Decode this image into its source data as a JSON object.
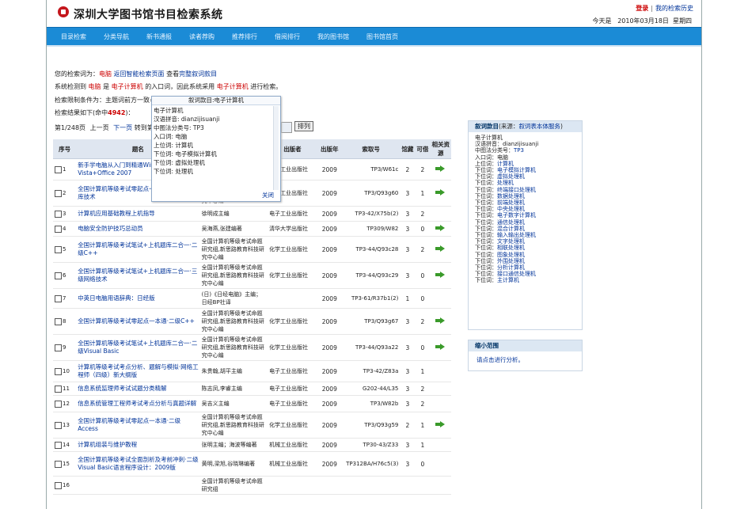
{
  "header": {
    "title": "深圳大学图书馆书目检索系统",
    "login": "登录",
    "separator": "|",
    "history": "我的检索历史",
    "date_label": "今天是",
    "date": "2010年03月18日",
    "weekday": "星期四"
  },
  "nav": [
    "目录检索",
    "分类导航",
    "新书通报",
    "读者荐购",
    "推荐排行",
    "借阅排行",
    "我的图书馆",
    "图书馆首页"
  ],
  "search_info": {
    "query_label": "您的检索词为：",
    "query": "电脑",
    "back_link": "返回智能检索页面",
    "view_label": "查看",
    "full_link": "完整叙词款目",
    "detect_pre": "系统检测到",
    "detect_term": "电脑",
    "detect_is": "是",
    "detect_target": "电子计算机",
    "detect_mid": "的入口词，因此系统采用",
    "detect_target2": "电子计算机",
    "detect_post": "进行检索。",
    "limit_label": "检索限制条件为：主题词前方一致=",
    "result_label": "检索结果如下(命中",
    "hits": "4942",
    "result_end": ")："
  },
  "pager": {
    "page_info": "第1/248页",
    "prev": "上一页",
    "next": "下一页",
    "jump_label": "转到第",
    "page_value": "1",
    "sort_button": "排列"
  },
  "table": {
    "headers": [
      "序号",
      "题名",
      "著者",
      "出版者",
      "出版年",
      "索取号",
      "馆藏",
      "可借",
      "相关资源"
    ],
    "rows": [
      {
        "n": "1",
        "title": "新手学电脑从入门到精通Windows Vista+Office 2007",
        "author": "",
        "publisher": "机械工业出版社",
        "year": "2009",
        "call": "TP3/W61c",
        "holdings": "2",
        "avail": "2",
        "res": true
      },
      {
        "n": "2",
        "title": "全国计算机等级考试零起点一本通：四级数据库技术",
        "author": "全国计算机等级考试命题研究组,新思路教育科技研究中心编",
        "publisher": "化学工业出版社",
        "year": "2009",
        "call": "TP3/Q93g60",
        "holdings": "3",
        "avail": "1",
        "res": true
      },
      {
        "n": "3",
        "title": "计算机应用基础教程上机指导",
        "author": "徐明成主编",
        "publisher": "电子工业出版社",
        "year": "2009",
        "call": "TP3-42/X75b(2)",
        "holdings": "3",
        "avail": "2",
        "res": false
      },
      {
        "n": "4",
        "title": "电脑安全防护技巧总动员",
        "author": "吴海燕,张建编著",
        "publisher": "清华大学出版社",
        "year": "2009",
        "call": "TP309/W82",
        "holdings": "3",
        "avail": "0",
        "res": true
      },
      {
        "n": "5",
        "title": "全国计算机等级考试笔试+上机题库二合一·二级C++",
        "author": "全国计算机等级考试命题研究组,新思路教育科技研究中心编",
        "publisher": "化学工业出版社",
        "year": "2009",
        "call": "TP3-44/Q93c28",
        "holdings": "3",
        "avail": "2",
        "res": true
      },
      {
        "n": "6",
        "title": "全国计算机等级考试笔试+上机题库二合一·三级网络技术",
        "author": "全国计算机等级考试命题研究组,新思路教育科技研究中心编",
        "publisher": "化学工业出版社",
        "year": "2009",
        "call": "TP3-44/Q93c29",
        "holdings": "3",
        "avail": "0",
        "res": true
      },
      {
        "n": "7",
        "title": "中英日电脑用语辞典：日经版",
        "author": "(日)《日经电脑》主编；日经BP社译",
        "publisher": "",
        "year": "2009",
        "call": "TP3-61/R37b1(2)",
        "holdings": "1",
        "avail": "0",
        "res": false
      },
      {
        "n": "8",
        "title": "全国计算机等级考试零起点一本通·二级C++",
        "author": "全国计算机等级考试命题研究组,新思路教育科技研究中心编",
        "publisher": "化学工业出版社",
        "year": "2009",
        "call": "TP3/Q93g67",
        "holdings": "3",
        "avail": "2",
        "res": true
      },
      {
        "n": "9",
        "title": "全国计算机等级考试笔试+上机题库二合一·二级Visual Basic",
        "author": "全国计算机等级考试命题研究组,新思路教育科技研究中心编",
        "publisher": "化学工业出版社",
        "year": "2009",
        "call": "TP3-44/Q93a22",
        "holdings": "3",
        "avail": "0",
        "res": true
      },
      {
        "n": "10",
        "title": "计算机等级考试考点分析、题解与模拟·网络工程师（四级）新大纲版",
        "author": "朱贵翰,胡平主编",
        "publisher": "电子工业出版社",
        "year": "2009",
        "call": "TP3-42/Z83a",
        "holdings": "3",
        "avail": "1",
        "res": false
      },
      {
        "n": "11",
        "title": "信息系统监理师考试试题分类精解",
        "author": "陈志凤,李睿主编",
        "publisher": "电子工业出版社",
        "year": "2009",
        "call": "G202-44/L35",
        "holdings": "3",
        "avail": "2",
        "res": false
      },
      {
        "n": "12",
        "title": "信息系统管理工程师考试考点分析与真题详解",
        "author": "吴吉义主编",
        "publisher": "电子工业出版社",
        "year": "2009",
        "call": "TP3/W82b",
        "holdings": "3",
        "avail": "2",
        "res": false
      },
      {
        "n": "13",
        "title": "全国计算机等级考试零起点一本通·二级Access",
        "author": "全国计算机等级考试命题研究组,新思路教育科技研究中心编",
        "publisher": "化学工业出版社",
        "year": "2009",
        "call": "TP3/Q93g59",
        "holdings": "2",
        "avail": "1",
        "res": true
      },
      {
        "n": "14",
        "title": "计算机组装与维护教程",
        "author": "张明主编；海波等编著",
        "publisher": "机械工业出版社",
        "year": "2009",
        "call": "TP30-43/Z33",
        "holdings": "3",
        "avail": "1",
        "res": false
      },
      {
        "n": "15",
        "title": "全国计算机等级考试全面剖析及考前冲刺·二级Visual Basic语言程序设计：2009版",
        "author": "黄明,梁旭,谷晓琳编著",
        "publisher": "机械工业出版社",
        "year": "2009",
        "call": "TP312BA/H76c5(3)",
        "holdings": "3",
        "avail": "0",
        "res": false
      },
      {
        "n": "16",
        "title": "",
        "author": "全国计算机等级考试命题研究组",
        "publisher": "",
        "year": "",
        "call": "",
        "holdings": "",
        "avail": "",
        "res": false
      }
    ]
  },
  "popup": {
    "title": "叙词款目:电子计算机",
    "lines": [
      "电子计算机",
      "汉语拼音: dianzijisuanji",
      "中图法分类号: TP3",
      "入口词: 电脑",
      "上位词: 计算机",
      "下位词: 电子模拟计算机",
      "下位词: 虚拟处理机",
      "下位词: 处理机"
    ],
    "close": "关闭"
  },
  "thesaurus_panel": {
    "head_title": "叙词款目",
    "head_source_pre": "(来源：",
    "head_source_link": "叙词表本体服务",
    "head_source_post": ")",
    "lines": [
      {
        "label": "电子计算机",
        "link": ""
      },
      {
        "label": "汉语拼音：",
        "link": "dianzijisuanji",
        "plain": true
      },
      {
        "label": "中图法分类号：",
        "link": "TP3"
      },
      {
        "label": "入口词：",
        "link": "电脑",
        "plain": true
      },
      {
        "label": "上位词：",
        "link": "计算机"
      },
      {
        "label": "下位词：",
        "link": "电子模拟计算机"
      },
      {
        "label": "下位词：",
        "link": "虚拟处理机"
      },
      {
        "label": "下位词：",
        "link": "处理机"
      },
      {
        "label": "下位词：",
        "link": "终端接口处理机"
      },
      {
        "label": "下位词：",
        "link": "数据处理机"
      },
      {
        "label": "下位词：",
        "link": "前端处理机"
      },
      {
        "label": "下位词：",
        "link": "中央处理机"
      },
      {
        "label": "下位词：",
        "link": "电子数字计算机"
      },
      {
        "label": "下位词：",
        "link": "通信处理机"
      },
      {
        "label": "下位词：",
        "link": "混合计算机"
      },
      {
        "label": "下位词：",
        "link": "输入输出处理机"
      },
      {
        "label": "下位词：",
        "link": "文字处理机"
      },
      {
        "label": "下位词：",
        "link": "相联处理机"
      },
      {
        "label": "下位词：",
        "link": "图象处理机"
      },
      {
        "label": "下位词：",
        "link": "外围处理机"
      },
      {
        "label": "下位词：",
        "link": "分析计算机"
      },
      {
        "label": "下位词：",
        "link": "接口通信处理机"
      },
      {
        "label": "下位词：",
        "link": "主计算机"
      }
    ]
  },
  "narrow_panel": {
    "title": "缩小范围",
    "hint": "请点击进行分析。"
  },
  "colors": {
    "nav_bg": "#1b8bd6",
    "link": "#003399",
    "accent_red": "#cc0000",
    "resource_arrow": "#3a9a2a"
  },
  "icons": {
    "resource": "green-arrow-icon",
    "logo": "university-seal-icon"
  }
}
